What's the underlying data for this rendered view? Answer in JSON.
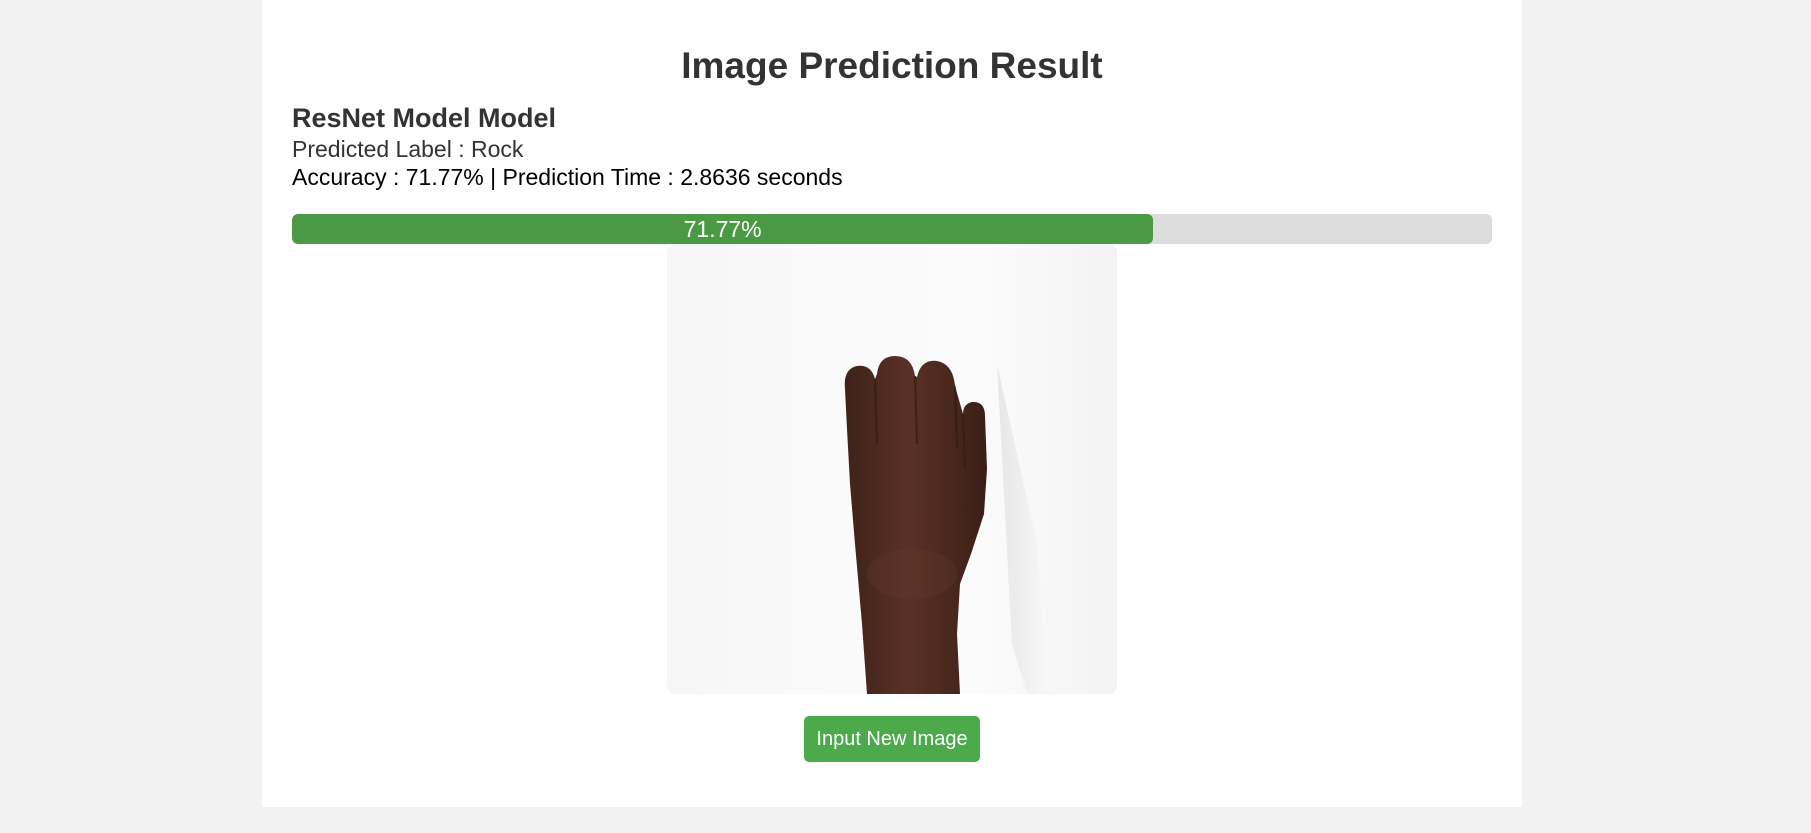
{
  "page": {
    "title": "Image Prediction Result"
  },
  "result": {
    "model_name": "ResNet Model Model",
    "predicted_label_text": "Predicted Label : Rock",
    "metrics_text": "Accuracy : 71.77% | Prediction Time : 2.8636 seconds",
    "accuracy_percent": 71.77,
    "progress_label": "71.77%"
  },
  "image": {
    "alt": "Rock"
  },
  "actions": {
    "new_image_label": "Input New Image"
  },
  "colors": {
    "progress_fill": "#4a9a45",
    "progress_track": "#dddddd",
    "button": "#4caa4b",
    "page_background": "#f2f2f2"
  }
}
